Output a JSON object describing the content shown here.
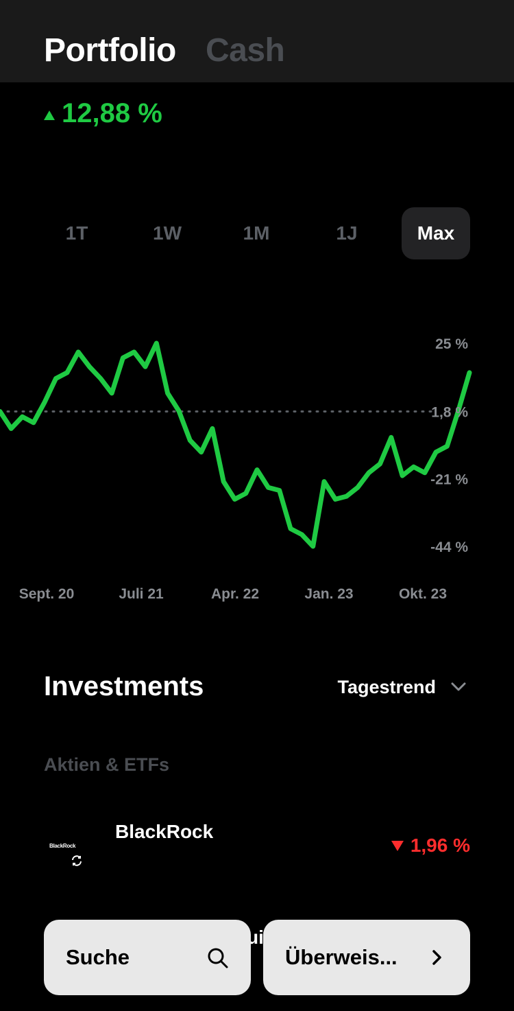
{
  "header": {
    "tabs": [
      {
        "label": "Portfolio",
        "active": true
      },
      {
        "label": "Cash",
        "active": false
      }
    ]
  },
  "performance": {
    "value": "12,88 %",
    "direction": "up",
    "color": "#1fca43"
  },
  "time_ranges": {
    "items": [
      "1T",
      "1W",
      "1M",
      "1J",
      "Max"
    ],
    "selected": "Max"
  },
  "chart_data": {
    "type": "line",
    "x_ticks": [
      "Sept. 20",
      "Juli 21",
      "Apr. 22",
      "Jan. 23",
      "Okt. 23"
    ],
    "y_ticks": [
      "25 %",
      "1,8 %",
      "-21 %",
      "-44 %"
    ],
    "y_tick_values": [
      25,
      1.8,
      -21,
      -44
    ],
    "reference_line": 1.8,
    "ylim": [
      -44,
      25
    ],
    "line_color": "#1fca43",
    "series": [
      {
        "x": [
          "2020-06",
          "2020-07",
          "2020-08",
          "2020-09",
          "2020-10",
          "2020-11",
          "2020-12",
          "2021-01",
          "2021-02",
          "2021-03",
          "2021-04",
          "2021-05",
          "2021-06",
          "2021-07",
          "2021-08",
          "2021-09",
          "2021-10",
          "2021-11",
          "2021-12",
          "2022-01",
          "2022-02",
          "2022-03",
          "2022-04",
          "2022-05",
          "2022-06",
          "2022-07",
          "2022-08",
          "2022-09",
          "2022-10",
          "2022-11",
          "2022-12",
          "2023-01",
          "2023-02",
          "2023-03",
          "2023-04",
          "2023-05",
          "2023-06",
          "2023-07",
          "2023-08",
          "2023-09",
          "2023-10",
          "2023-11",
          "2023-12"
        ],
        "values": [
          1.8,
          -4,
          0,
          -2,
          5,
          13,
          15,
          22,
          17,
          13,
          8,
          20,
          22,
          17,
          25,
          8,
          2,
          -8,
          -12,
          -4,
          -22,
          -28,
          -26,
          -18,
          -24,
          -25,
          -38,
          -40,
          -44,
          -22,
          -28,
          -27,
          -24,
          -19,
          -16,
          -7,
          -20,
          -17,
          -19,
          -12,
          -10,
          2,
          15
        ]
      }
    ]
  },
  "investments": {
    "title": "Investments",
    "sort_label": "Tagestrend",
    "section": "Aktien & ETFs",
    "holdings": [
      {
        "name": "BlackRock",
        "logo_text": "BlackRock",
        "change": "1,96 %",
        "direction": "down",
        "color": "#ff2d2d"
      }
    ],
    "peek_text": "ui"
  },
  "bottom_bar": {
    "search_label": "Suche",
    "transfer_label": "Überweis..."
  },
  "icons": [
    "search-icon",
    "chevron-right-icon",
    "chevron-down-icon",
    "refresh-icon"
  ]
}
